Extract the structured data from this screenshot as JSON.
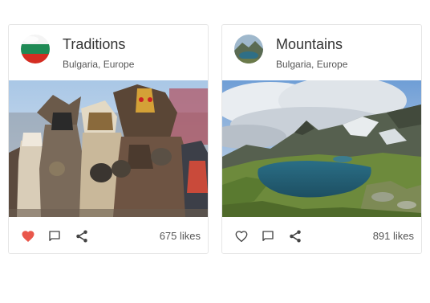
{
  "cards": [
    {
      "title": "Traditions",
      "subtitle": "Bulgaria, Europe",
      "likes_label": "675 likes",
      "liked": true,
      "avatar_icon": "bulgarian-flag",
      "image": "kukeri-masked-dancers"
    },
    {
      "title": "Mountains",
      "subtitle": "Bulgaria, Europe",
      "likes_label": "891 likes",
      "liked": false,
      "avatar_icon": "mountain-lake",
      "image": "mountain-lake-landscape"
    }
  ],
  "colors": {
    "like_active": "#e9574b",
    "icon": "#444444"
  }
}
